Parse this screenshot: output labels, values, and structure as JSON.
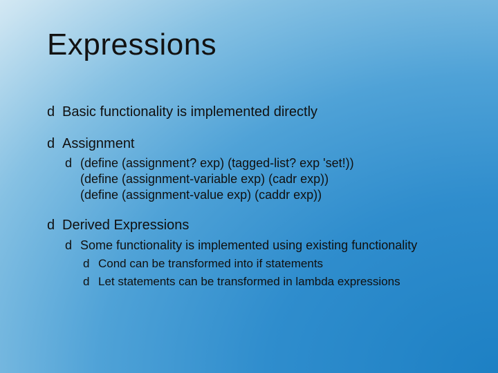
{
  "title": "Expressions",
  "bullets": {
    "b1_basic": "Basic functionality is implemented directly",
    "b1_assignment": "Assignment",
    "b2_code": "(define (assignment? exp)   (tagged-list? exp 'set!))  (define (assignment-variable exp) (cadr exp)) (define (assignment-value exp) (caddr exp))",
    "b1_derived": "Derived Expressions",
    "b2_some": "Some functionality is implemented using existing functionality",
    "b3_cond": "Cond can be transformed into if statements",
    "b3_let": "Let statements can be transformed in lambda expressions"
  },
  "bullet_glyph": "d"
}
